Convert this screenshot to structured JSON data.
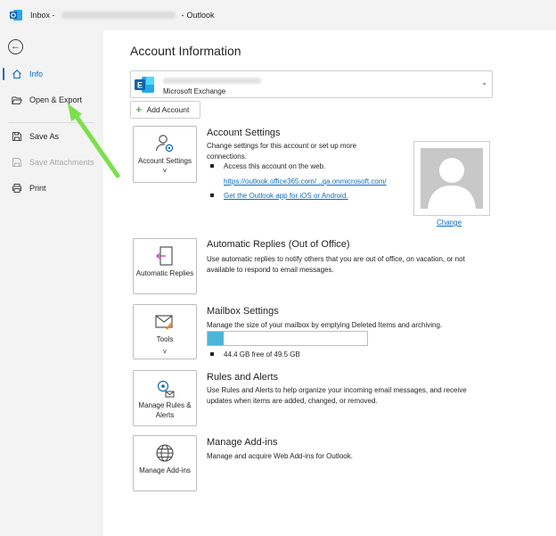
{
  "titlebar": {
    "inbox_label": "Inbox -",
    "separator": "-",
    "app_name": "Outlook"
  },
  "sidebar": {
    "items": [
      {
        "label": "Info",
        "icon": "home-icon",
        "state": "active"
      },
      {
        "label": "Open & Export",
        "icon": "folder-open-icon",
        "state": "normal"
      },
      {
        "label": "Save As",
        "icon": "save-as-icon",
        "state": "normal"
      },
      {
        "label": "Save Attachments",
        "icon": "save-attachments-icon",
        "state": "disabled"
      },
      {
        "label": "Print",
        "icon": "printer-icon",
        "state": "normal"
      }
    ]
  },
  "main": {
    "title": "Account Information",
    "account_type": "Microsoft Exchange",
    "add_account_label": "Add Account",
    "sections": {
      "account_settings": {
        "tile_label": "Account Settings ˅",
        "title": "Account Settings",
        "desc": "Change settings for this account or set up more connections.",
        "bullet1": "Access this account on the web.",
        "link1": "https://outlook.office365.com/...qa.onmicrosoft.com/",
        "link2": "Get the Outlook app for iOS or Android.",
        "change_label": "Change"
      },
      "auto_replies": {
        "tile_label": "Automatic Replies",
        "title": "Automatic Replies (Out of Office)",
        "desc": "Use automatic replies to notify others that you are out of office, on vacation, or not available to respond to email messages."
      },
      "mailbox": {
        "tile_label": "Tools",
        "tile_chevron": "˅",
        "title": "Mailbox Settings",
        "desc": "Manage the size of your mailbox by emptying Deleted Items and archiving.",
        "usage_text": "44.4 GB free of 49.5 GB",
        "used_fraction": 0.103
      },
      "rules": {
        "tile_label": "Manage Rules & Alerts",
        "title": "Rules and Alerts",
        "desc": "Use Rules and Alerts to help organize your incoming email messages, and receive updates when items are added, changed, or removed."
      },
      "addins": {
        "tile_label": "Manage Add-ins",
        "title": "Manage Add-ins",
        "desc": "Manage and acquire Web Add-ins for Outlook."
      }
    }
  },
  "colors": {
    "accent": "#0f6cbd",
    "arrow": "#7be04a",
    "progress": "#4fb5d6"
  }
}
